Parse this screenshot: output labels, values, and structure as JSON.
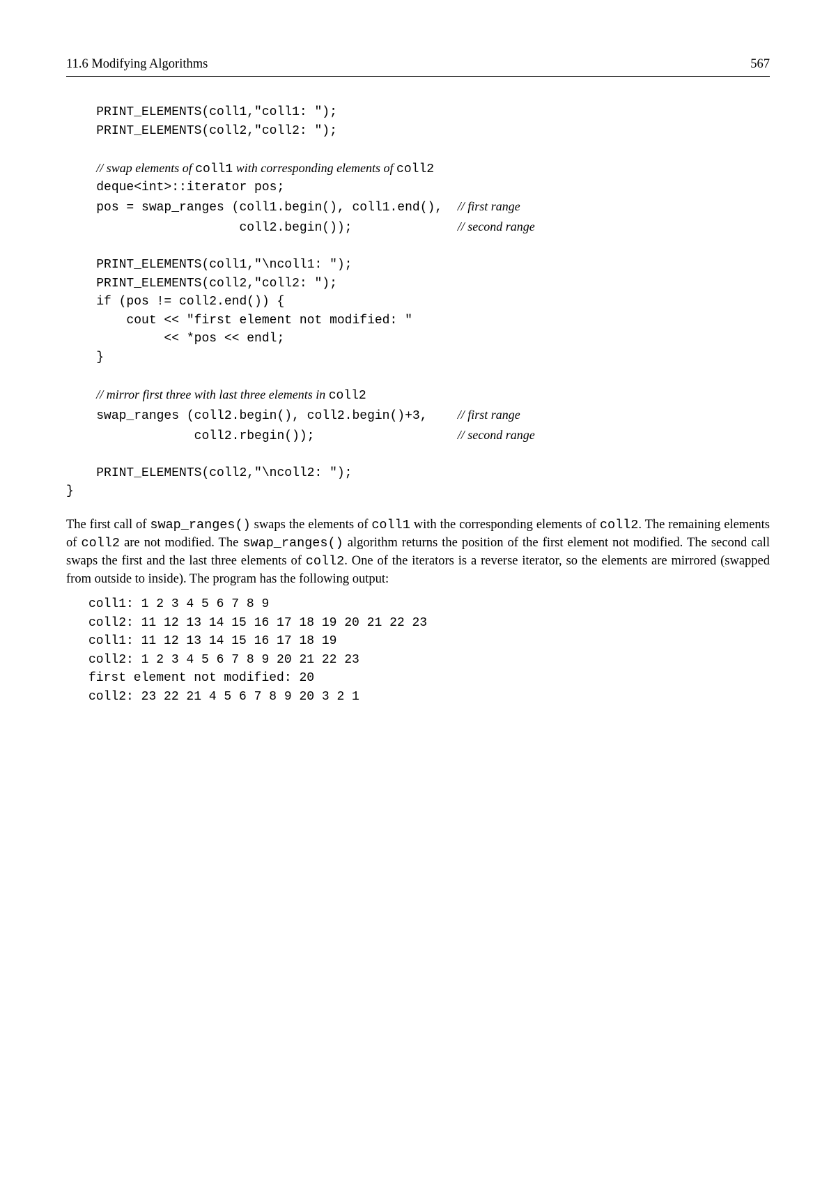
{
  "header": {
    "section": "11.6  Modifying Algorithms",
    "page": "567"
  },
  "code": {
    "indent1": "    ",
    "indent2": "        ",
    "l1": "PRINT_ELEMENTS(coll1,\"coll1: \");",
    "l2": "PRINT_ELEMENTS(coll2,\"coll2: \");",
    "c1_pre": "// swap elements of ",
    "c1_code1": "coll1",
    "c1_mid": " with corresponding elements of ",
    "c1_code2": "coll2",
    "l3": "deque<int>::iterator pos;",
    "l4": "pos = swap_ranges (coll1.begin(), coll1.end(),  ",
    "c4": "// first range",
    "l5": "                   coll2.begin());              ",
    "c5": "// second range",
    "l6": "PRINT_ELEMENTS(coll1,\"\\ncoll1: \");",
    "l7": "PRINT_ELEMENTS(coll2,\"coll2: \");",
    "l8": "if (pos != coll2.end()) {",
    "l9": "    cout << \"first element not modified: \"",
    "l10": "         << *pos << endl;",
    "l11": "}",
    "c2_pre": "// mirror first three with last three elements in ",
    "c2_code": "coll2",
    "l12": "swap_ranges (coll2.begin(), coll2.begin()+3,    ",
    "c12": "// first range",
    "l13": "             coll2.rbegin());                   ",
    "c13": "// second range",
    "l14": "PRINT_ELEMENTS(coll2,\"\\ncoll2: \");",
    "l15": "}"
  },
  "para": {
    "p1a": "The first call of ",
    "p1b": "swap_ranges()",
    "p1c": " swaps the elements of ",
    "p1d": "coll1",
    "p1e": " with the corresponding elements of ",
    "p1f": "coll2",
    "p1g": ". The remaining elements of ",
    "p1h": "coll2",
    "p1i": " are not modified. The ",
    "p1j": "swap_ranges()",
    "p1k": " algorithm returns the position of the first element not modified.  The second call swaps the first and the last three elements of ",
    "p1l": "coll2",
    "p1m": ". One of the iterators is a reverse iterator, so the elements are mirrored (swapped from outside to inside). The program has the following output:"
  },
  "output": {
    "o1": "coll1: 1 2 3 4 5 6 7 8 9",
    "o2": "coll2: 11 12 13 14 15 16 17 18 19 20 21 22 23",
    "o3": "",
    "o4": "coll1: 11 12 13 14 15 16 17 18 19",
    "o5": "coll2: 1 2 3 4 5 6 7 8 9 20 21 22 23",
    "o6": "first element not modified: 20",
    "o7": "",
    "o8": "coll2: 23 22 21 4 5 6 7 8 9 20 3 2 1"
  }
}
